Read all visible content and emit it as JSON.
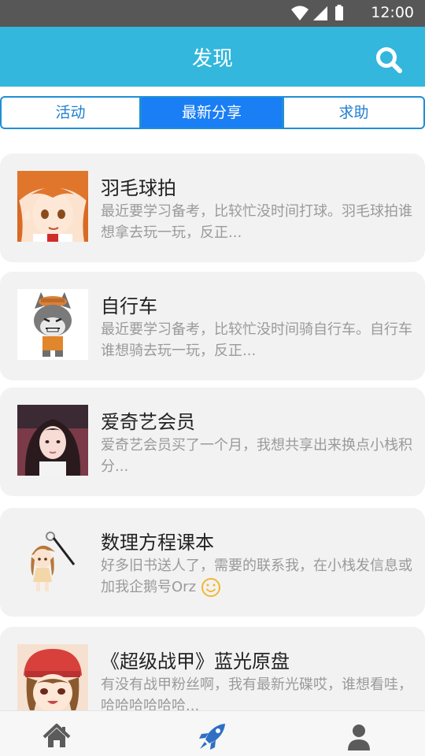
{
  "status_bar": {
    "time": "12:00"
  },
  "header": {
    "title": "发现"
  },
  "tabs": [
    {
      "label": "活动"
    },
    {
      "label": "最新分享"
    },
    {
      "label": "求助"
    }
  ],
  "feed": [
    {
      "title": "羽毛球拍",
      "desc": "最近要学习备考，比较忙没时间打球。羽毛球拍谁想拿去玩一玩，反正..."
    },
    {
      "title": "自行车",
      "desc": "最近要学习备考，比较忙没时间骑自行车。自行车谁想骑去玩一玩，反正..."
    },
    {
      "title": "爱奇艺会员",
      "desc": "爱奇艺会员买了一个月，我想共享出来换点小栈积分..."
    },
    {
      "title": "数理方程课本",
      "desc": "好多旧书送人了，需要的联系我，在小栈发信息或加我企鹅号Orz"
    },
    {
      "title": "《超级战甲》蓝光原盘",
      "desc": "有没有战甲粉丝啊，我有最新光碟哎，谁想看哇，哈哈哈哈哈哈..."
    }
  ],
  "colors": {
    "header": "#33b7dc",
    "tab_active": "#1a7ef5",
    "nav_active": "#2f6fc4"
  },
  "icons": {
    "search": "search-icon",
    "home": "home-icon",
    "discover": "rocket-icon",
    "profile": "user-icon"
  }
}
